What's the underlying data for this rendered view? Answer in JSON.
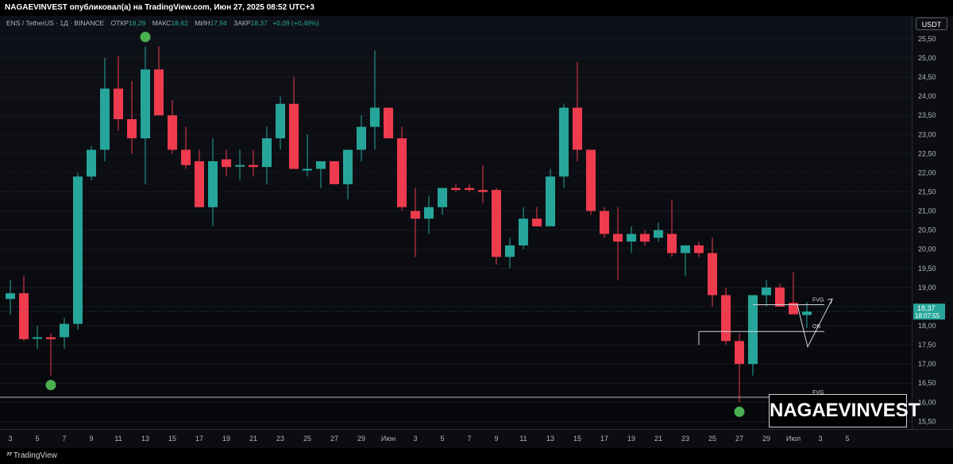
{
  "header": {
    "publisher_line": "NAGAEVINVEST опубликовал(а) на TradingView.com, Июн 27, 2025 08:52 UTC+3"
  },
  "legend": {
    "symbol": "ENS / TetherUS · 1Д · BINANCE",
    "open_label": "ОТКР",
    "open": "18,28",
    "high_label": "МАКС",
    "high": "18,62",
    "low_label": "МИН",
    "low": "17,94",
    "close_label": "ЗАКР",
    "close": "18,37",
    "change": "+0,09 (+0,49%)"
  },
  "currency_button": "USDT",
  "last_price": {
    "price": "18,37",
    "countdown": "18:07:55"
  },
  "watermark": "NAGAEVINVEST",
  "footer": {
    "brand": "TradingView"
  },
  "colors": {
    "up": "#26a69a",
    "down": "#ef3b4e",
    "marker": "#4caf50",
    "background": "#0b0d12"
  },
  "chart_data": {
    "type": "candlestick",
    "ylim": [
      15.3,
      26.1
    ],
    "y_ticks": [
      "15,50",
      "16,00",
      "16,50",
      "17,00",
      "17,50",
      "18,00",
      "18,50",
      "19,00",
      "19,50",
      "20,00",
      "20,50",
      "21,00",
      "21,50",
      "22,00",
      "22,50",
      "23,00",
      "23,50",
      "24,00",
      "24,50",
      "25,00",
      "25,50"
    ],
    "x_ticks": [
      "3",
      "5",
      "7",
      "9",
      "11",
      "13",
      "15",
      "17",
      "19",
      "21",
      "23",
      "25",
      "27",
      "29",
      "Июн",
      "3",
      "5",
      "7",
      "9",
      "11",
      "13",
      "15",
      "17",
      "19",
      "21",
      "23",
      "25",
      "27",
      "29",
      "Июл",
      "3",
      "5"
    ],
    "candles": [
      {
        "o": 18.7,
        "h": 19.2,
        "l": 18.3,
        "c": 18.85
      },
      {
        "o": 18.85,
        "h": 19.3,
        "l": 17.6,
        "c": 17.65
      },
      {
        "o": 17.7,
        "h": 18.0,
        "l": 17.4,
        "c": 17.7
      },
      {
        "o": 17.7,
        "h": 17.8,
        "l": 16.7,
        "c": 17.65
      },
      {
        "o": 17.7,
        "h": 18.2,
        "l": 17.4,
        "c": 18.05
      },
      {
        "o": 18.05,
        "h": 22.0,
        "l": 17.9,
        "c": 21.9
      },
      {
        "o": 21.9,
        "h": 22.7,
        "l": 21.8,
        "c": 22.6
      },
      {
        "o": 22.6,
        "h": 25.0,
        "l": 22.3,
        "c": 24.2
      },
      {
        "o": 24.2,
        "h": 25.05,
        "l": 23.1,
        "c": 23.4
      },
      {
        "o": 23.4,
        "h": 24.4,
        "l": 22.5,
        "c": 22.9
      },
      {
        "o": 22.9,
        "h": 25.3,
        "l": 21.7,
        "c": 24.7
      },
      {
        "o": 24.7,
        "h": 25.3,
        "l": 23.5,
        "c": 23.5
      },
      {
        "o": 23.5,
        "h": 23.9,
        "l": 22.5,
        "c": 22.6
      },
      {
        "o": 22.6,
        "h": 23.2,
        "l": 22.1,
        "c": 22.2
      },
      {
        "o": 22.3,
        "h": 22.6,
        "l": 21.1,
        "c": 21.1
      },
      {
        "o": 21.1,
        "h": 22.9,
        "l": 20.6,
        "c": 22.3
      },
      {
        "o": 22.35,
        "h": 22.6,
        "l": 21.9,
        "c": 22.15
      },
      {
        "o": 22.2,
        "h": 22.6,
        "l": 21.8,
        "c": 22.2
      },
      {
        "o": 22.2,
        "h": 22.6,
        "l": 21.9,
        "c": 22.15
      },
      {
        "o": 22.15,
        "h": 23.2,
        "l": 21.7,
        "c": 22.9
      },
      {
        "o": 22.9,
        "h": 24.0,
        "l": 22.6,
        "c": 23.8
      },
      {
        "o": 23.8,
        "h": 24.5,
        "l": 22.1,
        "c": 22.1
      },
      {
        "o": 22.1,
        "h": 23.0,
        "l": 21.9,
        "c": 22.1
      },
      {
        "o": 22.1,
        "h": 22.3,
        "l": 21.6,
        "c": 22.3
      },
      {
        "o": 22.3,
        "h": 22.3,
        "l": 21.8,
        "c": 21.7
      },
      {
        "o": 21.7,
        "h": 22.4,
        "l": 21.3,
        "c": 22.6
      },
      {
        "o": 22.6,
        "h": 23.5,
        "l": 22.3,
        "c": 23.2
      },
      {
        "o": 23.2,
        "h": 25.2,
        "l": 22.6,
        "c": 23.7
      },
      {
        "o": 23.7,
        "h": 23.7,
        "l": 22.9,
        "c": 22.9
      },
      {
        "o": 22.9,
        "h": 23.2,
        "l": 21.0,
        "c": 21.1
      },
      {
        "o": 21.0,
        "h": 21.6,
        "l": 19.8,
        "c": 20.8
      },
      {
        "o": 20.8,
        "h": 21.4,
        "l": 20.4,
        "c": 21.1
      },
      {
        "o": 21.1,
        "h": 21.6,
        "l": 20.9,
        "c": 21.6
      },
      {
        "o": 21.6,
        "h": 21.7,
        "l": 21.5,
        "c": 21.55
      },
      {
        "o": 21.6,
        "h": 21.7,
        "l": 21.5,
        "c": 21.55
      },
      {
        "o": 21.55,
        "h": 22.2,
        "l": 21.2,
        "c": 21.5
      },
      {
        "o": 21.55,
        "h": 21.6,
        "l": 19.6,
        "c": 19.8
      },
      {
        "o": 19.8,
        "h": 20.3,
        "l": 19.5,
        "c": 20.1
      },
      {
        "o": 20.1,
        "h": 21.1,
        "l": 20.0,
        "c": 20.8
      },
      {
        "o": 20.8,
        "h": 21.1,
        "l": 20.6,
        "c": 20.6
      },
      {
        "o": 20.6,
        "h": 22.1,
        "l": 20.6,
        "c": 21.9
      },
      {
        "o": 21.9,
        "h": 23.8,
        "l": 21.6,
        "c": 23.7
      },
      {
        "o": 23.7,
        "h": 24.9,
        "l": 22.3,
        "c": 22.6
      },
      {
        "o": 22.6,
        "h": 22.6,
        "l": 20.9,
        "c": 21.0
      },
      {
        "o": 21.0,
        "h": 21.1,
        "l": 20.3,
        "c": 20.4
      },
      {
        "o": 20.4,
        "h": 21.1,
        "l": 19.2,
        "c": 20.2
      },
      {
        "o": 20.2,
        "h": 20.6,
        "l": 19.9,
        "c": 20.4
      },
      {
        "o": 20.4,
        "h": 20.5,
        "l": 20.1,
        "c": 20.2
      },
      {
        "o": 20.3,
        "h": 20.7,
        "l": 20.2,
        "c": 20.5
      },
      {
        "o": 20.4,
        "h": 21.3,
        "l": 19.8,
        "c": 19.9
      },
      {
        "o": 19.9,
        "h": 20.1,
        "l": 19.3,
        "c": 20.1
      },
      {
        "o": 20.1,
        "h": 20.2,
        "l": 19.8,
        "c": 19.9
      },
      {
        "o": 19.9,
        "h": 20.3,
        "l": 18.5,
        "c": 18.8
      },
      {
        "o": 18.8,
        "h": 19.0,
        "l": 17.5,
        "c": 17.6
      },
      {
        "o": 17.6,
        "h": 17.8,
        "l": 16.0,
        "c": 17.0
      },
      {
        "o": 17.0,
        "h": 18.8,
        "l": 16.7,
        "c": 18.8
      },
      {
        "o": 18.8,
        "h": 19.2,
        "l": 18.5,
        "c": 19.0
      },
      {
        "o": 19.0,
        "h": 19.1,
        "l": 18.5,
        "c": 18.5
      },
      {
        "o": 18.6,
        "h": 19.4,
        "l": 18.3,
        "c": 18.3
      },
      {
        "o": 18.28,
        "h": 18.62,
        "l": 17.94,
        "c": 18.37
      }
    ],
    "annotations": {
      "labels": [
        "FVG",
        "OB",
        "FVG"
      ],
      "levels": [
        18.55,
        17.85,
        16.13
      ]
    },
    "last_price_level": 18.37,
    "swing_markers": [
      {
        "candle": 10,
        "position": "high"
      },
      {
        "candle": 3,
        "position": "low"
      },
      {
        "candle": 54,
        "position": "low"
      }
    ]
  }
}
